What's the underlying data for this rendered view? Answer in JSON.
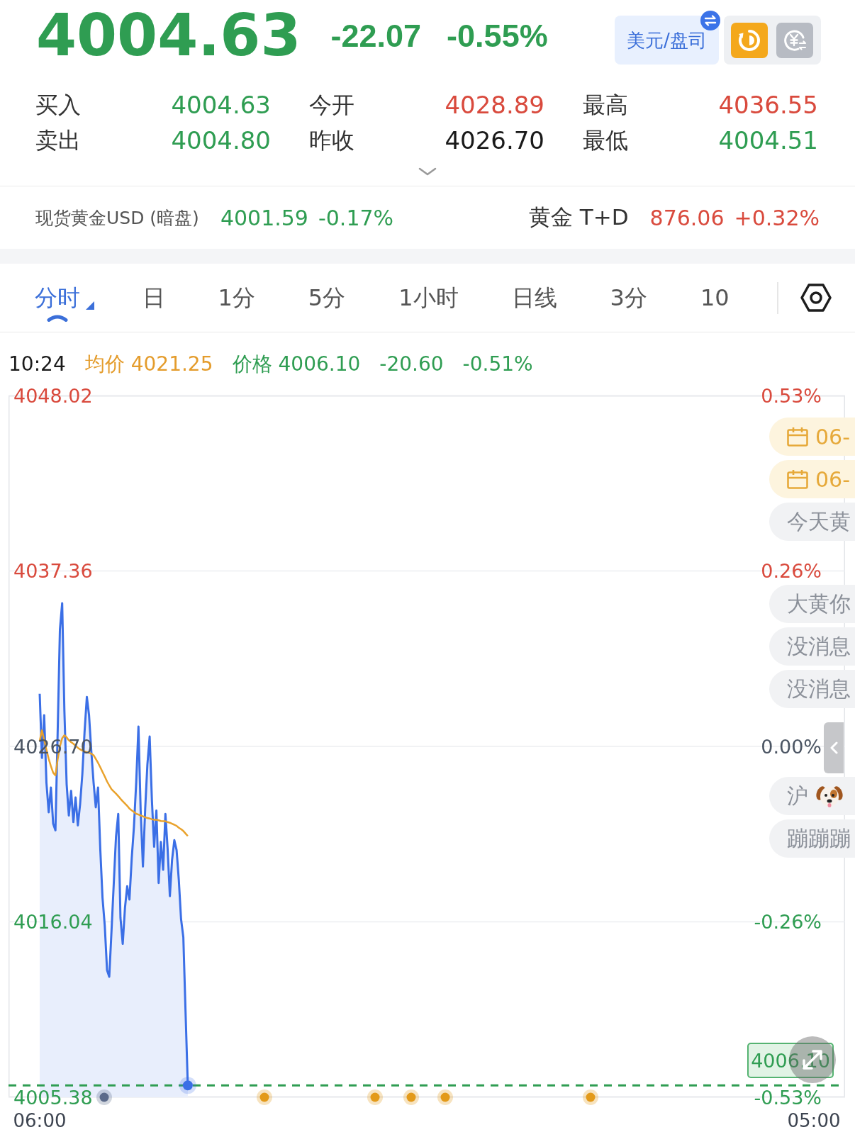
{
  "quote": {
    "price": "4004.63",
    "change": "-22.07",
    "change_percent": "-0.55%",
    "color": "#2f9d52"
  },
  "unit_button": {
    "label": "美元/盘司"
  },
  "stats": [
    {
      "label": "买入",
      "value": "4004.63",
      "color": "#2f9d52"
    },
    {
      "label": "今开",
      "value": "4028.89",
      "color": "#d94a3d"
    },
    {
      "label": "最高",
      "value": "4036.55",
      "color": "#d94a3d"
    },
    {
      "label": "卖出",
      "value": "4004.80",
      "color": "#2f9d52"
    },
    {
      "label": "昨收",
      "value": "4026.70",
      "color": "#1a1a1a"
    },
    {
      "label": "最低",
      "value": "4004.51",
      "color": "#2f9d52"
    }
  ],
  "related": [
    {
      "kind": "small",
      "name": "现货黄金USD (暗盘)",
      "price": "4001.59",
      "change_percent": "-0.17%",
      "color": "#2f9d52"
    },
    {
      "kind": "large",
      "name": "黄金 T+D",
      "price": "876.06",
      "change_percent": "+0.32%",
      "color": "#d94a3d"
    }
  ],
  "tabs": [
    {
      "label": "分时",
      "selected": true
    },
    {
      "label": "日",
      "selected": false
    },
    {
      "label": "1分",
      "selected": false
    },
    {
      "label": "5分",
      "selected": false
    },
    {
      "label": "1小时",
      "selected": false
    },
    {
      "label": "日线",
      "selected": false
    },
    {
      "label": "3分",
      "selected": false
    },
    {
      "label": "10",
      "selected": false
    }
  ],
  "readout": {
    "time": "10:24",
    "items": [
      {
        "kind": "average",
        "label": "均价",
        "value": "4021.25"
      },
      {
        "kind": "price",
        "label": "价格",
        "value": "4006.10"
      }
    ],
    "change": "-20.60",
    "change_percent": "-0.51%",
    "color": "#2f9d52"
  },
  "chart": {
    "chart_data": {
      "type": "line",
      "grid": true,
      "categories": [
        "06:00",
        null,
        null,
        null,
        null,
        null,
        null,
        null,
        null,
        null,
        null,
        null,
        null,
        null,
        null,
        null,
        null,
        null,
        null,
        null,
        null,
        null,
        null,
        null,
        null,
        null,
        null,
        null,
        null,
        null,
        null,
        null,
        null,
        null,
        null,
        null,
        null,
        null,
        null,
        null,
        null,
        null,
        null,
        null,
        null,
        null,
        null,
        null,
        null,
        null,
        null,
        null,
        null,
        null,
        null,
        null,
        null,
        null,
        null,
        null,
        null,
        null,
        null,
        null,
        null,
        null,
        null,
        null,
        null,
        null,
        null,
        null,
        null,
        null,
        null,
        null,
        null,
        null,
        null,
        null,
        null,
        null,
        null,
        null,
        null,
        null,
        null,
        null,
        null,
        null,
        null,
        null,
        null,
        null,
        null,
        null,
        null,
        null,
        null,
        null,
        null,
        null,
        null,
        null,
        null,
        null,
        null,
        null,
        null,
        null,
        null,
        null,
        null,
        null,
        null,
        null,
        null,
        null,
        null,
        null,
        null,
        null,
        null,
        null,
        null,
        null,
        null,
        null,
        null,
        null,
        null,
        null,
        null,
        null,
        null,
        null,
        null,
        null,
        null,
        null,
        null,
        null,
        null,
        null,
        null,
        null,
        null,
        null,
        null,
        null,
        null,
        null,
        null,
        null,
        null,
        null,
        null,
        null,
        null,
        null,
        null,
        null,
        null,
        null,
        null,
        null,
        null,
        null,
        null,
        null,
        null,
        null,
        null,
        null,
        null,
        null,
        null,
        null,
        null,
        null,
        null,
        null,
        null,
        null,
        null,
        null,
        null,
        null,
        null,
        null,
        null,
        null,
        null,
        null,
        null,
        null,
        null,
        null,
        null,
        null,
        null,
        null,
        null,
        null,
        null,
        null,
        null,
        null,
        null,
        null,
        null,
        null,
        null,
        null,
        null,
        null,
        null,
        null,
        null,
        null,
        null,
        null,
        null,
        null,
        null,
        null,
        null,
        null,
        null,
        null,
        null,
        null,
        null,
        null,
        null,
        null,
        null,
        null,
        null,
        null,
        null,
        null,
        null,
        null,
        null,
        null,
        null,
        null,
        null,
        null,
        null,
        null,
        null,
        null,
        null,
        null,
        null,
        null,
        null,
        null,
        null,
        null,
        null,
        null,
        null,
        null,
        null,
        null,
        null,
        null,
        null,
        null,
        null,
        null,
        null,
        null,
        null,
        null,
        null,
        null,
        null,
        null,
        null,
        null,
        null,
        null,
        null,
        null,
        null,
        null,
        null,
        null,
        null,
        null,
        null,
        null,
        null,
        null,
        null,
        null,
        null,
        null,
        null,
        null,
        null,
        null,
        null,
        null,
        null,
        null,
        null,
        null,
        null,
        null,
        null,
        null,
        null,
        null,
        null,
        null,
        null,
        null,
        null,
        null,
        null,
        null,
        null,
        null,
        null,
        null,
        null,
        null,
        null,
        null,
        null,
        null,
        null,
        null,
        null,
        null,
        null,
        null,
        null,
        null,
        null,
        "05:00"
      ],
      "ylim": [
        4005.38,
        4048.02
      ],
      "yticks": [
        {
          "value": 4048.02,
          "label": "4048.02"
        },
        {
          "value": 4037.36,
          "label": "4037.36"
        },
        {
          "value": 4026.7,
          "label": "4026.70"
        },
        {
          "value": 4016.04,
          "label": "4016.04"
        },
        {
          "value": 4005.38,
          "label": "4005.38"
        }
      ],
      "series": [
        {
          "color": "#3b6fe6",
          "values": [
            4029.9,
            4026.0,
            4028.6,
            4024.5,
            4022.7,
            4024.2,
            4022.0,
            4021.6,
            4027.5,
            4033.8,
            4035.4,
            4028.9,
            4024.4,
            4022.5,
            4024.0,
            4022.1,
            4023.6,
            4021.9,
            4023.2,
            4025.0,
            4027.6,
            4029.7,
            4028.6,
            4026.4,
            4024.5,
            4023.0,
            4024.2,
            4020.4,
            4017.5,
            4015.8,
            4013.1,
            4012.7,
            4015.5,
            4018.4,
            4021.2,
            4022.6,
            4016.3,
            4014.7,
            4016.9,
            4018.2,
            4017.4,
            4019.9,
            4021.8,
            4024.5,
            4027.9,
            4022.8,
            4019.4,
            4022.9,
            4025.6,
            4027.3,
            4023.4,
            4020.6,
            4022.8,
            4018.4,
            4020.9,
            4019.2,
            4022.6,
            4020.5,
            4017.6,
            4019.8,
            4021.0,
            4020.4,
            4018.6,
            4016.2,
            4015.1,
            4010.6,
            4006.1,
            null,
            null,
            null,
            null,
            null,
            null,
            null,
            null,
            null,
            null,
            null,
            null,
            null,
            null,
            null,
            null,
            null,
            null,
            null,
            null,
            null,
            null,
            null,
            null,
            null,
            null,
            null,
            null,
            null,
            null,
            null,
            null,
            null,
            null,
            null,
            null,
            null,
            null,
            null,
            null,
            null,
            null,
            null,
            null,
            null,
            null,
            null,
            null,
            null,
            null,
            null,
            null,
            null,
            null,
            null,
            null,
            null,
            null,
            null,
            null,
            null,
            null,
            null,
            null,
            null,
            null,
            null,
            null,
            null,
            null,
            null,
            null,
            null,
            null,
            null,
            null,
            null,
            null,
            null,
            null,
            null,
            null,
            null,
            null,
            null,
            null,
            null,
            null,
            null,
            null,
            null,
            null,
            null,
            null,
            null,
            null,
            null,
            null,
            null,
            null,
            null,
            null,
            null,
            null,
            null,
            null,
            null,
            null,
            null,
            null,
            null,
            null,
            null,
            null,
            null,
            null,
            null,
            null,
            null,
            null,
            null,
            null,
            null,
            null,
            null,
            null,
            null,
            null,
            null,
            null,
            null,
            null,
            null,
            null,
            null,
            null,
            null,
            null,
            null,
            null,
            null,
            null,
            null,
            null,
            null,
            null,
            null,
            null,
            null,
            null,
            null,
            null,
            null,
            null,
            null,
            null,
            null,
            null,
            null,
            null,
            null,
            null,
            null,
            null,
            null,
            null,
            null,
            null,
            null,
            null,
            null,
            null,
            null,
            null,
            null,
            null,
            null,
            null,
            null,
            null,
            null,
            null,
            null,
            null,
            null,
            null,
            null,
            null,
            null,
            null,
            null,
            null,
            null,
            null,
            null,
            null,
            null,
            null,
            null,
            null,
            null,
            null,
            null,
            null,
            null,
            null,
            null,
            null,
            null,
            null,
            null,
            null,
            null,
            null,
            null,
            null,
            null,
            null,
            null,
            null,
            null,
            null,
            null,
            null,
            null,
            null,
            null,
            null,
            null,
            null,
            null,
            null,
            null,
            null,
            null,
            null,
            null,
            null,
            null,
            null,
            null,
            null,
            null,
            null,
            null,
            null,
            null,
            null,
            null,
            null,
            null,
            null,
            null,
            null,
            null,
            null,
            null,
            null,
            null,
            null,
            null,
            null,
            null,
            null,
            null,
            null,
            null,
            null,
            null,
            null,
            null,
            null,
            null,
            null,
            null,
            null,
            null,
            null,
            null
          ]
        },
        {
          "color": "#e9a22c",
          "values": [
            4027.03,
            4027.68,
            4027.1,
            4026.5,
            4025.94,
            4025.5,
            4025.1,
            4024.94,
            4025.9,
            4026.7,
            4027.2,
            4027.38,
            4027.25,
            4027.07,
            4026.96,
            4026.86,
            4026.74,
            4026.62,
            4026.52,
            4026.45,
            4026.39,
            4026.35,
            4026.31,
            4026.26,
            4026.16,
            4025.94,
            4025.7,
            4025.43,
            4025.15,
            4024.87,
            4024.57,
            4024.33,
            4024.1,
            4023.96,
            4023.83,
            4023.68,
            4023.52,
            4023.37,
            4023.23,
            4023.09,
            4022.92,
            4022.81,
            4022.71,
            4022.61,
            4022.56,
            4022.5,
            4022.45,
            4022.39,
            4022.35,
            4022.32,
            4022.27,
            4022.24,
            4022.24,
            4022.21,
            4022.17,
            4022.15,
            4022.15,
            4022.1,
            4022.06,
            4022.0,
            4021.94,
            4021.87,
            4021.76,
            4021.67,
            4021.56,
            4021.41,
            4021.25,
            null,
            null,
            null,
            null,
            null,
            null,
            null,
            null,
            null,
            null,
            null,
            null,
            null,
            null,
            null,
            null,
            null,
            null,
            null,
            null,
            null,
            null,
            null,
            null,
            null,
            null,
            null,
            null,
            null,
            null,
            null,
            null,
            null,
            null,
            null,
            null,
            null,
            null,
            null,
            null,
            null,
            null,
            null,
            null,
            null,
            null,
            null,
            null,
            null,
            null,
            null,
            null,
            null,
            null,
            null,
            null,
            null,
            null,
            null,
            null,
            null,
            null,
            null,
            null,
            null,
            null,
            null,
            null,
            null,
            null,
            null,
            null,
            null,
            null,
            null,
            null,
            null,
            null,
            null,
            null,
            null,
            null,
            null,
            null,
            null,
            null,
            null,
            null,
            null,
            null,
            null,
            null,
            null,
            null,
            null,
            null,
            null,
            null,
            null,
            null,
            null,
            null,
            null,
            null,
            null,
            null,
            null,
            null,
            null,
            null,
            null,
            null,
            null,
            null,
            null,
            null,
            null,
            null,
            null,
            null,
            null,
            null,
            null,
            null,
            null,
            null,
            null,
            null,
            null,
            null,
            null,
            null,
            null,
            null,
            null,
            null,
            null,
            null,
            null,
            null,
            null,
            null,
            null,
            null,
            null,
            null,
            null,
            null,
            null,
            null,
            null,
            null,
            null,
            null,
            null,
            null,
            null,
            null,
            null,
            null,
            null,
            null,
            null,
            null,
            null,
            null,
            null,
            null,
            null,
            null,
            null,
            null,
            null,
            null,
            null,
            null,
            null,
            null,
            null,
            null,
            null,
            null,
            null,
            null,
            null,
            null,
            null,
            null,
            null,
            null,
            null,
            null,
            null,
            null,
            null,
            null,
            null,
            null,
            null,
            null,
            null,
            null,
            null,
            null,
            null,
            null,
            null,
            null,
            null,
            null,
            null,
            null,
            null,
            null,
            null,
            null,
            null,
            null,
            null,
            null,
            null,
            null,
            null,
            null,
            null,
            null,
            null,
            null,
            null,
            null,
            null,
            null,
            null,
            null,
            null,
            null,
            null,
            null,
            null,
            null,
            null,
            null,
            null,
            null,
            null,
            null,
            null,
            null,
            null,
            null,
            null,
            null,
            null,
            null,
            null,
            null,
            null,
            null,
            null,
            null,
            null,
            null,
            null,
            null,
            null,
            null,
            null,
            null,
            null,
            null,
            null,
            null,
            null,
            null,
            null,
            null,
            null,
            null,
            null
          ]
        }
      ],
      "ref_lines": [
        {
          "axis": "y",
          "value": 4006.1,
          "label": "4006.10"
        }
      ]
    },
    "event_markers": [
      {
        "color": "#5b6a8a"
      },
      {
        "color": "#e39a1a"
      },
      {
        "color": "#e39a1a"
      },
      {
        "color": "#e39a1a"
      },
      {
        "color": "#e39a1a"
      },
      {
        "color": "#e39a1a"
      }
    ],
    "percent_ticks": [
      {
        "label": "0.53%",
        "color": "#d94a3d"
      },
      {
        "label": "0.26%",
        "color": "#d94a3d"
      },
      {
        "label": "0.00%",
        "color": "#4b5563"
      },
      {
        "label": "-0.26%",
        "color": "#2f9d52"
      },
      {
        "label": "-0.53%",
        "color": "#2f9d52"
      }
    ],
    "comments": [
      {
        "kind": "calendar",
        "text": "06-"
      },
      {
        "kind": "calendar",
        "text": "06-"
      },
      {
        "kind": "text",
        "text": "今天黄"
      },
      {
        "kind": "text",
        "text": "大黄你"
      },
      {
        "kind": "text",
        "text": "没消息"
      },
      {
        "kind": "text",
        "text": "没消息"
      },
      {
        "kind": "emoji",
        "text": "沪"
      },
      {
        "kind": "text",
        "text": "蹦蹦蹦"
      }
    ]
  }
}
